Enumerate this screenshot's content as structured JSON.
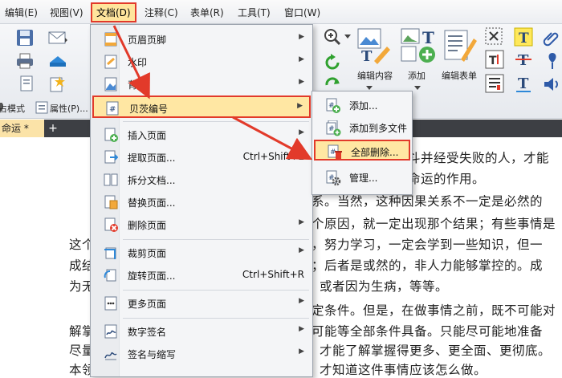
{
  "menubar": {
    "items": [
      "编辑(E)",
      "视图(V)",
      "文档(D)",
      "注释(C)",
      "表单(R)",
      "工具(T)",
      "窗口(W)"
    ],
    "active_index": 2
  },
  "ribbon": {
    "edit_content_label": "编辑内容",
    "add_label": "添加",
    "edit_form_label": "编辑表单",
    "mode_label": "占模式",
    "properties_label": "属性(P)..."
  },
  "tab": {
    "title": "命运 *",
    "add_symbol": "+"
  },
  "menu": {
    "items": [
      {
        "label": "页眉页脚",
        "shortcut": "",
        "has_submenu": true
      },
      {
        "label": "水印",
        "shortcut": "",
        "has_submenu": true
      },
      {
        "label": "背景",
        "shortcut": "",
        "has_submenu": true
      },
      {
        "label": "贝茨编号",
        "shortcut": "",
        "has_submenu": true,
        "highlighted": true
      },
      {
        "label": "插入页面",
        "shortcut": "",
        "has_submenu": true
      },
      {
        "label": "提取页面...",
        "shortcut": "Ctrl+Shift+E",
        "has_submenu": false
      },
      {
        "label": "拆分文档...",
        "shortcut": "",
        "has_submenu": false
      },
      {
        "label": "替换页面...",
        "shortcut": "",
        "has_submenu": false
      },
      {
        "label": "删除页面",
        "shortcut": "",
        "has_submenu": true
      },
      {
        "label": "裁剪页面",
        "shortcut": "",
        "has_submenu": true
      },
      {
        "label": "旋转页面...",
        "shortcut": "Ctrl+Shift+R",
        "has_submenu": false
      },
      {
        "label": "更多页面",
        "shortcut": "",
        "has_submenu": true
      },
      {
        "label": "数字签名",
        "shortcut": "",
        "has_submenu": true
      },
      {
        "label": "签名与缩写",
        "shortcut": "",
        "has_submenu": true
      }
    ]
  },
  "submenu": {
    "items": [
      {
        "label": "添加..."
      },
      {
        "label": "添加到多文件"
      },
      {
        "label": "全部删除...",
        "highlighted": true
      },
      {
        "label": "管理..."
      }
    ]
  },
  "document": {
    "lines": [
      "斗并经受失败的人，才能",
      "命运的作用。",
      "系。当然，这种因果关系不一定是必然的",
      "个原因，就一定出现那个结果；有些事情是",
      "这个",
      "，努力学习，一定会学到一些知识，但一",
      "成结",
      "；后者是或然的，非人力能够掌控的。成",
      "为无",
      "或者因为生病，等等。",
      "定条件。但是，在做事情之前，既不可能对",
      "解掌",
      "可能等全部条件具备。只能尽可能地准备",
      "尽量",
      "才能了解掌握得更多、更全面、更彻底。",
      "本领",
      "才知道这件事情应该怎么做。"
    ]
  },
  "colors": {
    "highlight_fill": "#ffe7a3",
    "highlight_border": "#e23a2a",
    "arrow": "#e23a2a",
    "tab_bg": "#fbe3a8"
  }
}
